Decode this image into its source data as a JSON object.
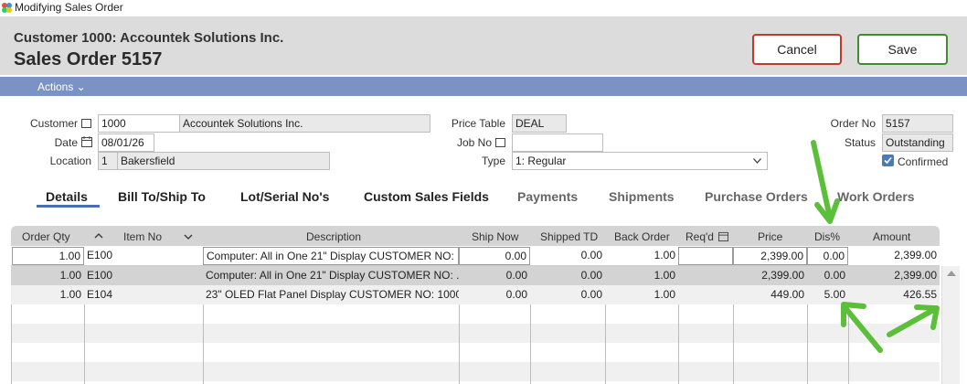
{
  "window": {
    "title": "Modifying Sales Order"
  },
  "header": {
    "customer_line": "Customer 1000: Accountek Solutions Inc.",
    "order_line": "Sales Order 5157",
    "cancel_label": "Cancel",
    "save_label": "Save"
  },
  "actions": {
    "label": "Actions ⌄"
  },
  "form": {
    "customer_label": "Customer",
    "customer_id": "1000",
    "customer_name": "Accountek Solutions Inc.",
    "date_label": "Date",
    "date_value": "08/01/26",
    "location_label": "Location",
    "location_id": "1",
    "location_name": "Bakersfield",
    "price_table_label": "Price Table",
    "price_table_value": "DEAL",
    "job_no_label": "Job No",
    "job_no_value": "",
    "type_label": "Type",
    "type_value": "1: Regular",
    "order_no_label": "Order No",
    "order_no_value": "5157",
    "status_label": "Status",
    "status_value": "Outstanding",
    "confirmed_label": "Confirmed",
    "confirmed_checked": true
  },
  "tabs": [
    {
      "label": "Details"
    },
    {
      "label": "Bill To/Ship To"
    },
    {
      "label": "Lot/Serial No's"
    },
    {
      "label": "Custom Sales Fields"
    },
    {
      "label": "Payments"
    },
    {
      "label": "Shipments"
    },
    {
      "label": "Purchase Orders"
    },
    {
      "label": "Work Orders"
    }
  ],
  "grid": {
    "columns": [
      "Order Qty",
      "Item No",
      "Description",
      "Ship Now",
      "Shipped TD",
      "Back Order",
      "Req'd",
      "Price",
      "Dis%",
      "Amount"
    ],
    "edit_row": {
      "qty": "1.00",
      "item": "E100",
      "desc": "Computer: All in One 21\" Display CUSTOMER NO: ...",
      "ship_now": "0.00",
      "shipped_td": "0.00",
      "back_order": "1.00",
      "reqd": "",
      "price": "2,399.00",
      "dis": "0.00",
      "amount": "2,399.00"
    },
    "rows": [
      {
        "qty": "1.00",
        "item": "E100",
        "desc": "Computer: All in One 21\" Display CUSTOMER NO: ...",
        "ship_now": "0.00",
        "shipped_td": "0.00",
        "back_order": "1.00",
        "reqd": "",
        "price": "2,399.00",
        "dis": "0.00",
        "amount": "2,399.00"
      },
      {
        "qty": "1.00",
        "item": "E104",
        "desc": "23\" OLED Flat Panel Display CUSTOMER NO: 10000...",
        "ship_now": "0.00",
        "shipped_td": "0.00",
        "back_order": "1.00",
        "reqd": "",
        "price": "449.00",
        "dis": "5.00",
        "amount": "426.55"
      }
    ]
  },
  "colors": {
    "accent": "#7b93c4",
    "cancel_border": "#c0392b",
    "save_border": "#3e8e2f",
    "annotation_arrow": "#5cbf3a"
  },
  "icons": [
    "app-icon",
    "lookup-icon",
    "calendar-icon",
    "sort-up-icon",
    "chevron-down-icon",
    "checkbox-icon",
    "scroll-up-icon",
    "annotation-arrow"
  ]
}
